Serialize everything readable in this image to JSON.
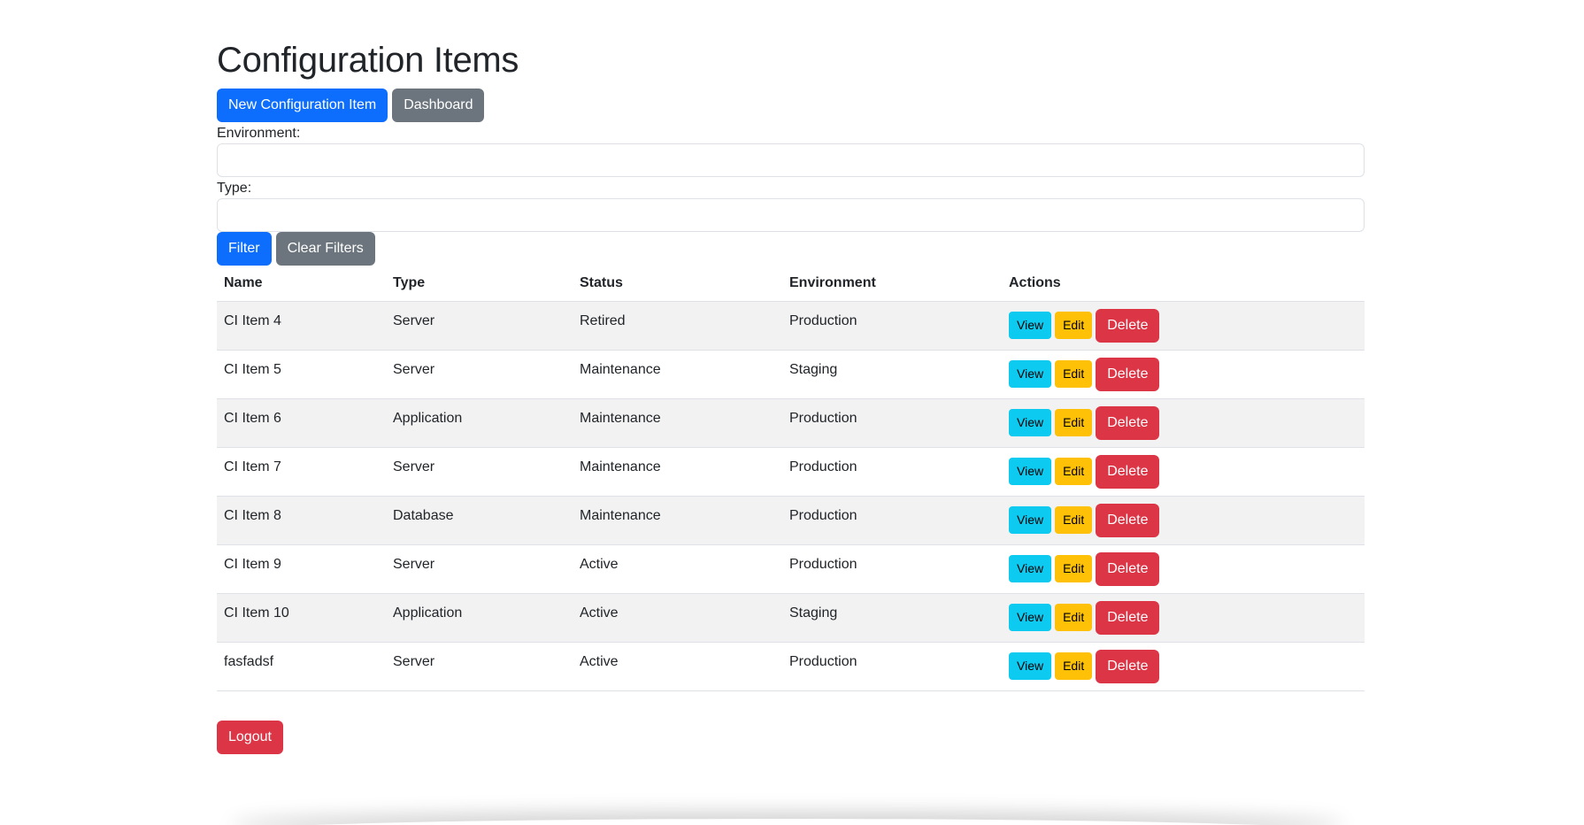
{
  "page": {
    "title": "Configuration Items"
  },
  "top_actions": {
    "new_label": "New Configuration Item",
    "dashboard_label": "Dashboard"
  },
  "filters": {
    "environment_label": "Environment:",
    "environment_value": "",
    "type_label": "Type:",
    "type_value": "",
    "filter_label": "Filter",
    "clear_label": "Clear Filters"
  },
  "table": {
    "headers": {
      "name": "Name",
      "type": "Type",
      "status": "Status",
      "environment": "Environment",
      "actions": "Actions"
    },
    "action_labels": {
      "view": "View",
      "edit": "Edit",
      "delete": "Delete"
    },
    "rows": [
      {
        "name": "CI Item 4",
        "type": "Server",
        "status": "Retired",
        "environment": "Production"
      },
      {
        "name": "CI Item 5",
        "type": "Server",
        "status": "Maintenance",
        "environment": "Staging"
      },
      {
        "name": "CI Item 6",
        "type": "Application",
        "status": "Maintenance",
        "environment": "Production"
      },
      {
        "name": "CI Item 7",
        "type": "Server",
        "status": "Maintenance",
        "environment": "Production"
      },
      {
        "name": "CI Item 8",
        "type": "Database",
        "status": "Maintenance",
        "environment": "Production"
      },
      {
        "name": "CI Item 9",
        "type": "Server",
        "status": "Active",
        "environment": "Production"
      },
      {
        "name": "CI Item 10",
        "type": "Application",
        "status": "Active",
        "environment": "Staging"
      },
      {
        "name": "fasfadsf",
        "type": "Server",
        "status": "Active",
        "environment": "Production"
      }
    ]
  },
  "footer": {
    "logout_label": "Logout"
  },
  "colors": {
    "primary": "#0d6efd",
    "secondary": "#6c757d",
    "danger": "#dc3545",
    "info": "#0dcaf0",
    "warning": "#ffc107",
    "stripe": "#f2f2f2"
  }
}
